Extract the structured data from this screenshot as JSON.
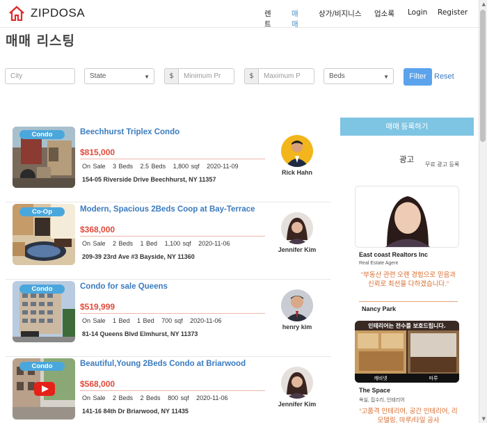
{
  "brand": {
    "name": "ZIPDOSA"
  },
  "nav": [
    {
      "label": "렌트",
      "active": false
    },
    {
      "label": "매매",
      "active": true
    },
    {
      "label": "상가/비지니스",
      "active": false
    },
    {
      "label": "업소록",
      "active": false
    },
    {
      "label": "Login",
      "active": false
    },
    {
      "label": "Register",
      "active": false
    }
  ],
  "page_title": "매매 리스팅",
  "filters": {
    "city_placeholder": "City",
    "state_value": "State",
    "currency_symbol": "$",
    "min_placeholder": "Minimum Pr",
    "max_placeholder": "Maximum P",
    "beds_value": "Beds",
    "filter_label": "Filter",
    "reset_label": "Reset"
  },
  "listings": [
    {
      "badge": "Condo",
      "title": "Beechhurst Triplex Condo",
      "price": "$815,000",
      "meta": "On Sale   3 Beds   2.5 Beds   1,800 sqf   2020-11-09",
      "address": "154-05 Riverside Drive Beechhurst, NY 11357",
      "agent": "Rick Hahn"
    },
    {
      "badge": "Co-Op",
      "title": "Modern, Spacious 2Beds Coop at Bay-Terrace",
      "price": "$368,000",
      "meta": "On Sale   2 Beds   1 Bed   1,100 sqf   2020-11-06",
      "address": "209-39 23rd Ave #3 Bayside, NY 11360",
      "agent": "Jennifer Kim"
    },
    {
      "badge": "Condo",
      "title": "Condo for sale Queens",
      "price": "$519,999",
      "meta": "On Sale   1 Bed   1 Bed   700 sqf   2020-11-06",
      "address": "81-14 Queens Blvd Elmhurst, NY 11373",
      "agent": "henry kim"
    },
    {
      "badge": "Condo",
      "title": "Beautiful,Young 2Beds Condo at Briarwood",
      "price": "$568,000",
      "meta": "On Sale   2 Beds   2 Beds   800 sqf   2020-11-06",
      "address": "141-16 84th Dr Briarwood, NY 11435",
      "agent": "Jennifer Kim"
    }
  ],
  "sidebar": {
    "register_label": "매매 등록하기",
    "ad_title": "광고",
    "ad_free": "무료 광고 등록",
    "ads": [
      {
        "name": "East coast Realtors Inc",
        "sub": "Real Estate Agent",
        "quote": "“부동산 관련 오랜 경험으로 믿음과 신뢰로 최선을 다하겠습니다.”",
        "person": "Nancy Park"
      },
      {
        "name": "The Space",
        "sub": "욕실, 집수리, 인테리어",
        "quote": "“고품격 인테리어, 공간 인테리어, 리모델링, 마루/타일 공사",
        "banner": "인테리어는 전수를 보호드립니다.",
        "tab1": "캐비넷",
        "tab2": "마루"
      }
    ]
  }
}
